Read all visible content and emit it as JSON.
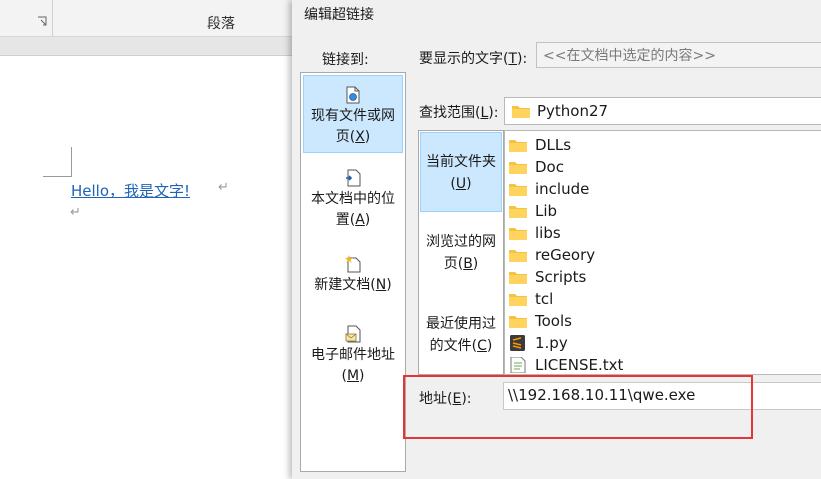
{
  "word": {
    "ribbon_group_label": "段落",
    "link_text": "Hello，我是文字!",
    "para_mark": "↵"
  },
  "dialog": {
    "title": "编辑超链接",
    "link_to_label": "链接到:",
    "link_to_items": [
      {
        "label": "现有文件或网页(X)",
        "line1": "现有文件或网",
        "line2_pre": "页(",
        "key": "X",
        "line2_post": ")",
        "icon": "existing-file-web-page-icon",
        "selected": true
      },
      {
        "label": "本文档中的位置(A)",
        "line1": "本文档中的位",
        "line2_pre": "置(",
        "key": "A",
        "line2_post": ")",
        "icon": "place-in-document-icon",
        "selected": false
      },
      {
        "label": "新建文档(N)",
        "line1": "新建文档(",
        "line2_pre": "",
        "key": "N",
        "line2_post": ")",
        "icon": "new-document-icon",
        "selected": false
      },
      {
        "label": "电子邮件地址(M)",
        "line1": "电子邮件地址",
        "line2_pre": "(",
        "key": "M",
        "line2_post": ")",
        "icon": "email-address-icon",
        "selected": false
      }
    ],
    "display_text_label": {
      "pre": "要显示的文字(",
      "key": "T",
      "post": "):"
    },
    "display_text_value": "<<在文档中选定的内容>>",
    "look_in_label": {
      "pre": "查找范围(",
      "key": "L",
      "post": "):"
    },
    "look_in_value": "Python27",
    "browse_items": [
      {
        "line1": "当前文件夹",
        "line2_pre": "(",
        "key": "U",
        "line2_post": ")",
        "selected": true
      },
      {
        "line1": "浏览过的网",
        "line2_pre": "页(",
        "key": "B",
        "line2_post": ")",
        "selected": false
      },
      {
        "line1": "最近使用过",
        "line2_pre": "的文件(",
        "key": "C",
        "line2_post": ")",
        "selected": false
      }
    ],
    "files": [
      {
        "name": "DLLs",
        "icon": "folder-icon"
      },
      {
        "name": "Doc",
        "icon": "folder-icon"
      },
      {
        "name": "include",
        "icon": "folder-icon"
      },
      {
        "name": "Lib",
        "icon": "folder-icon"
      },
      {
        "name": "libs",
        "icon": "folder-icon"
      },
      {
        "name": "reGeory",
        "icon": "folder-icon"
      },
      {
        "name": "Scripts",
        "icon": "folder-icon"
      },
      {
        "name": "tcl",
        "icon": "folder-icon"
      },
      {
        "name": "Tools",
        "icon": "folder-icon"
      },
      {
        "name": "1.py",
        "icon": "sublime-file-icon"
      },
      {
        "name": "LICENSE.txt",
        "icon": "text-file-icon"
      }
    ],
    "address_label": {
      "pre": "地址(",
      "key": "E",
      "post": "):"
    },
    "address_value": "\\\\192.168.10.11\\qwe.exe"
  },
  "colors": {
    "highlight_box": "#e53535",
    "selection_bg": "#cce8ff",
    "link": "#1e63b8",
    "folder": "#f5c242"
  }
}
